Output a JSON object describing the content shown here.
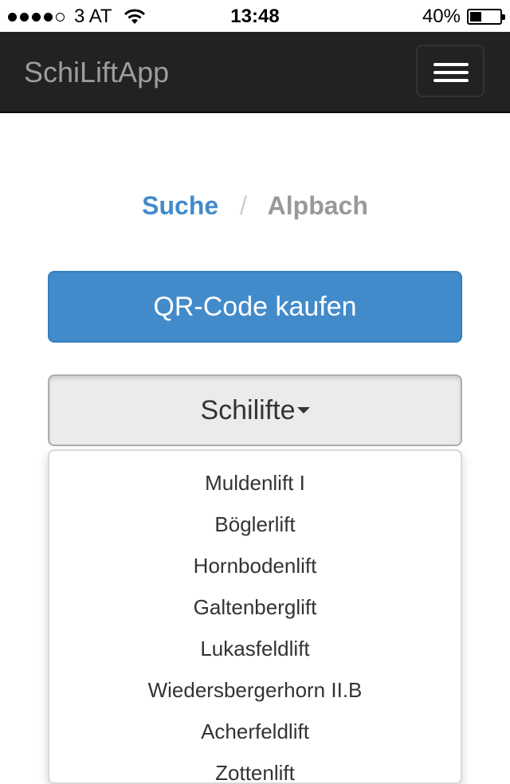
{
  "statusbar": {
    "carrier": "3 AT",
    "time": "13:48",
    "battery_percent": "40%",
    "battery_level": 0.4,
    "signal_strength": 4
  },
  "navbar": {
    "brand": "SchiLiftApp",
    "menu_icon": "hamburger-icon"
  },
  "breadcrumb": {
    "link": "Suche",
    "separator": "/",
    "active": "Alpbach"
  },
  "buttons": {
    "primary": "QR-Code kaufen",
    "dropdown": "Schilifte"
  },
  "dropdown_items": [
    "Muldenlift I",
    "Böglerlift",
    "Hornbodenlift",
    "Galtenberglift",
    "Lukasfeldlift",
    "Wiedersbergerhorn II.B",
    "Acherfeldlift",
    "Zottenlift"
  ],
  "colors": {
    "navbar": "#222222",
    "primary": "#428bca",
    "link": "#428bca"
  }
}
